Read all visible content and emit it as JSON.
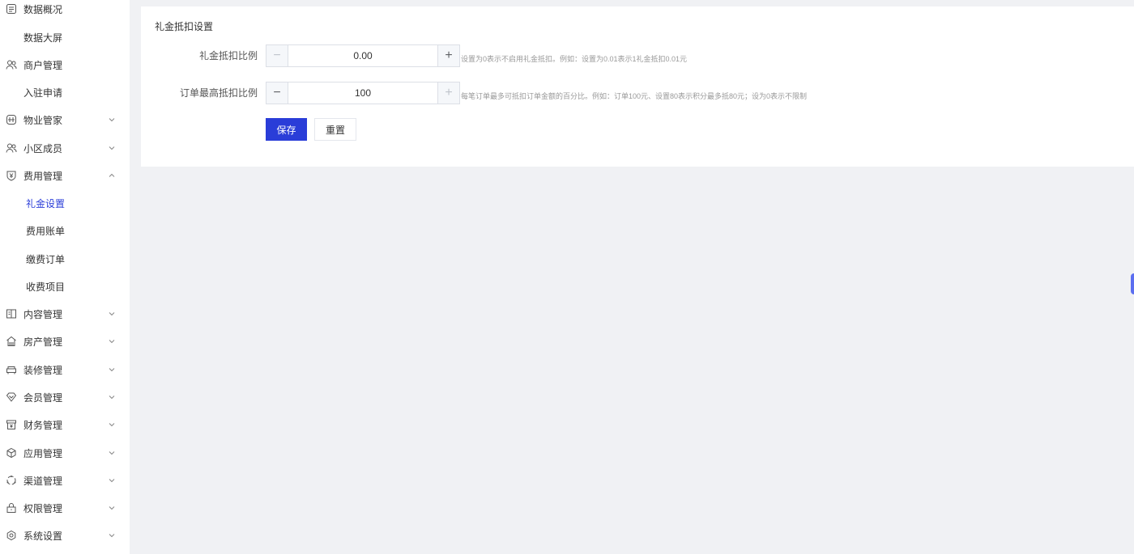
{
  "sidebar": {
    "items": [
      {
        "label": "数据概况",
        "icon": "dashboard-icon",
        "chevron": ""
      },
      {
        "label": "数据大屏",
        "icon": "",
        "chevron": ""
      },
      {
        "label": "商户管理",
        "icon": "users-icon",
        "chevron": ""
      },
      {
        "label": "入驻申请",
        "icon": "",
        "chevron": ""
      },
      {
        "label": "物业管家",
        "icon": "building-icon",
        "chevron": "down"
      },
      {
        "label": "小区成员",
        "icon": "users-icon",
        "chevron": "down"
      },
      {
        "label": "费用管理",
        "icon": "yuan-shield-icon",
        "chevron": "up"
      },
      {
        "label": "礼金设置",
        "icon": "",
        "chevron": "",
        "active": true
      },
      {
        "label": "费用账单",
        "icon": "",
        "chevron": ""
      },
      {
        "label": "缴费订单",
        "icon": "",
        "chevron": ""
      },
      {
        "label": "收费项目",
        "icon": "",
        "chevron": ""
      },
      {
        "label": "内容管理",
        "icon": "book-icon",
        "chevron": "down"
      },
      {
        "label": "房产管理",
        "icon": "house-icon",
        "chevron": "down"
      },
      {
        "label": "装修管理",
        "icon": "sofa-icon",
        "chevron": "down"
      },
      {
        "label": "会员管理",
        "icon": "diamond-icon",
        "chevron": "down"
      },
      {
        "label": "财务管理",
        "icon": "wallet-icon",
        "chevron": "down"
      },
      {
        "label": "应用管理",
        "icon": "cube-icon",
        "chevron": "down"
      },
      {
        "label": "渠道管理",
        "icon": "cycle-icon",
        "chevron": "down"
      },
      {
        "label": "权限管理",
        "icon": "lock-icon",
        "chevron": "down"
      },
      {
        "label": "系统设置",
        "icon": "gear-icon",
        "chevron": "down"
      }
    ]
  },
  "card": {
    "title": "礼金抵扣设置",
    "fields": [
      {
        "label": "礼金抵扣比例",
        "value": "0.00",
        "hint": "设置为0表示不启用礼金抵扣。例如：设置为0.01表示1礼金抵扣0.01元"
      },
      {
        "label": "订单最高抵扣比例",
        "value": "100",
        "hint": "每笔订单最多可抵扣订单金额的百分比。例如：订单100元、设置80表示积分最多抵80元；设为0表示不限制"
      }
    ],
    "save_label": "保存",
    "reset_label": "重置"
  },
  "colors": {
    "accent": "#2a3dd8",
    "background": "#f0f1f4"
  }
}
